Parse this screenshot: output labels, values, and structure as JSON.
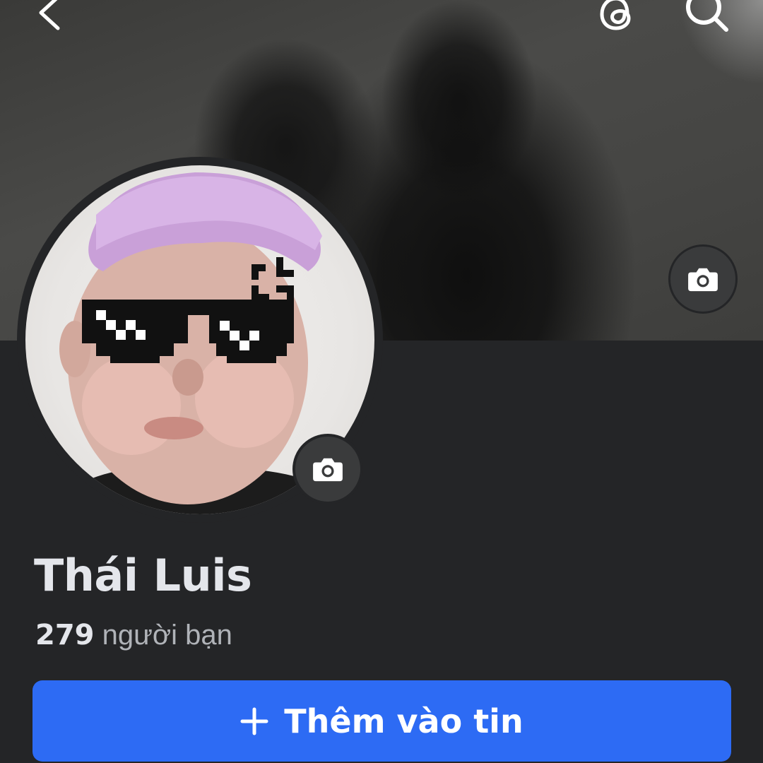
{
  "profile": {
    "name": "Thái Luis",
    "friends_count": "279",
    "friends_label": "người bạn"
  },
  "actions": {
    "add_story_label": "Thêm vào tin"
  },
  "icons": {
    "back": "chevron-left-icon",
    "threads": "threads-icon",
    "search": "search-icon",
    "cover_camera": "camera-icon",
    "avatar_camera": "camera-icon",
    "add_story": "plus-icon"
  },
  "colors": {
    "background": "#242527",
    "primary_button": "#2d6bf4",
    "text_primary": "#e4e6eb",
    "text_secondary": "#b0b3b8"
  }
}
